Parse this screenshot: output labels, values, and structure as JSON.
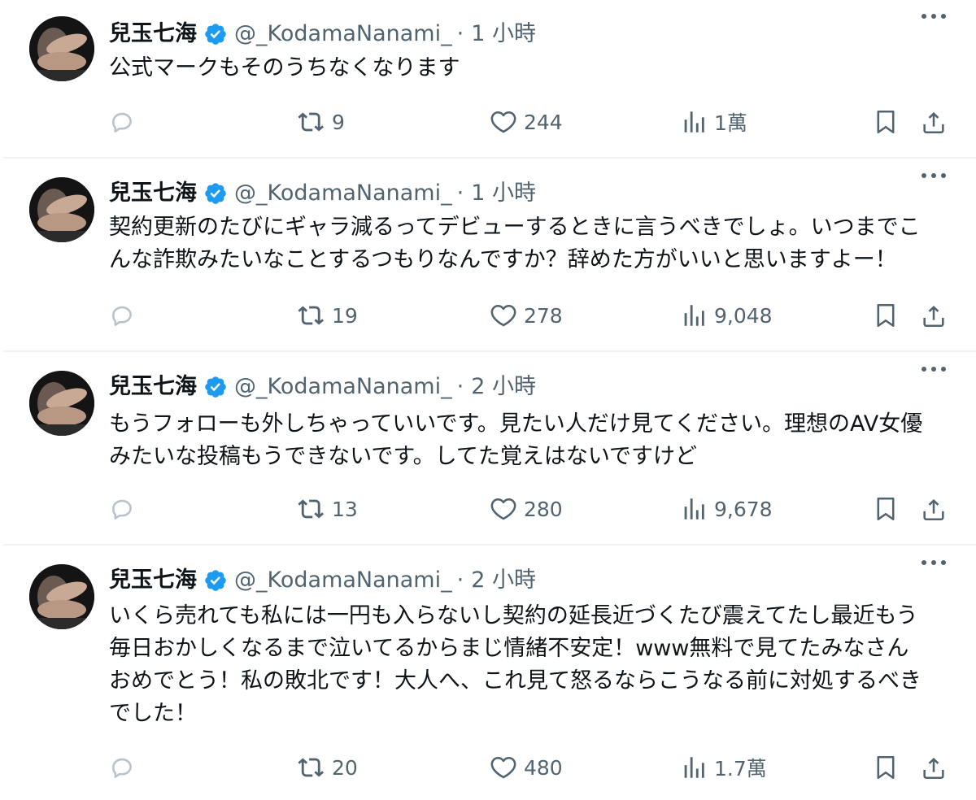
{
  "tweets": [
    {
      "name": "兒玉七海",
      "handle": "@_KodamaNanami_",
      "separator": "·",
      "time": "1 小時",
      "lines": [
        "公式マークもそのうちなくなります"
      ],
      "replies": "",
      "retweets": "9",
      "likes": "244",
      "views": "1萬"
    },
    {
      "name": "兒玉七海",
      "handle": "@_KodamaNanami_",
      "separator": "·",
      "time": "1 小時",
      "lines": [
        "契約更新のたびにギャラ減るってデビューするときに言うべきでしょ。いつまでこ",
        "んな詐欺みたいなことするつもりなんですか？辞めた方がいいと思いますよー！"
      ],
      "replies": "",
      "retweets": "19",
      "likes": "278",
      "views": "9,048"
    },
    {
      "name": "兒玉七海",
      "handle": "@_KodamaNanami_",
      "separator": "·",
      "time": "2 小時",
      "lines": [
        "もうフォローも外しちゃっていいです。見たい人だけ見てください。理想のAV女優",
        "みたいな投稿もうできないです。してた覚えはないですけど"
      ],
      "replies": "",
      "retweets": "13",
      "likes": "280",
      "views": "9,678"
    },
    {
      "name": "兒玉七海",
      "handle": "@_KodamaNanami_",
      "separator": "·",
      "time": "2 小時",
      "lines": [
        "いくら売れても私には一円も入らないし契約の延長近づくたび震えてたし最近もう",
        "毎日おかしくなるまで泣いてるからまじ情緒不安定！www無料で見てたみなさん",
        "おめでとう！私の敗北です！大人へ、これ見て怒るならこうなる前に対処するべき",
        "でした！"
      ],
      "replies": "",
      "retweets": "20",
      "likes": "480",
      "views": "1.7萬"
    }
  ],
  "icons": {
    "verified": "verified-badge-icon",
    "more": "more-options-icon",
    "reply": "reply-icon",
    "retweet": "retweet-icon",
    "like": "heart-icon",
    "views": "views-chart-icon",
    "bookmark": "bookmark-icon",
    "share": "share-icon"
  },
  "colors": {
    "text": "#0f1419",
    "secondary": "#536471",
    "verified": "#1d9bf0",
    "divider": "#eff3f4",
    "reply_icon": "#b9c3cb"
  }
}
